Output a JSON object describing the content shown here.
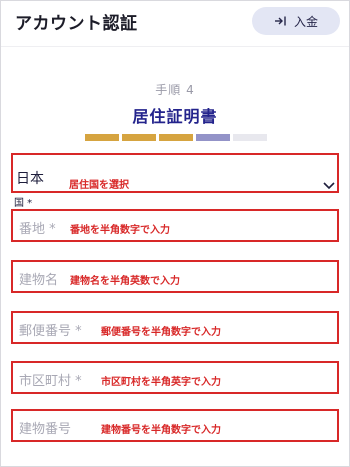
{
  "header": {
    "title": "アカウント認証",
    "deposit_label": "入金",
    "deposit_icon": "login-arrow-icon"
  },
  "step": {
    "label": "手順 4",
    "title": "居住証明書",
    "progress": {
      "total_steps": 5,
      "current_step": 4,
      "colors": {
        "done": "#d6a440",
        "current": "#9393c8",
        "todo": "#e8e8ee"
      }
    }
  },
  "form": {
    "country": {
      "value": "日本",
      "note": "居住国を選択",
      "caption": "国 *",
      "icon": "chevron-down-icon"
    },
    "fields": [
      {
        "placeholder": "番地 *",
        "note": "番地を半角数字で入力"
      },
      {
        "placeholder": "建物名",
        "note": "建物名を半角英数で入力"
      },
      {
        "placeholder": "郵便番号 *",
        "note": "郵便番号を半角数字で入力"
      },
      {
        "placeholder": "市区町村 *",
        "note": "市区町村を半角英字で入力"
      },
      {
        "placeholder": "建物番号",
        "note": "建物番号を半角数字で入力"
      }
    ]
  },
  "colors": {
    "accent": "#23238c",
    "highlight_box": "#d82828",
    "deposit_bg": "#e3e6f4"
  }
}
